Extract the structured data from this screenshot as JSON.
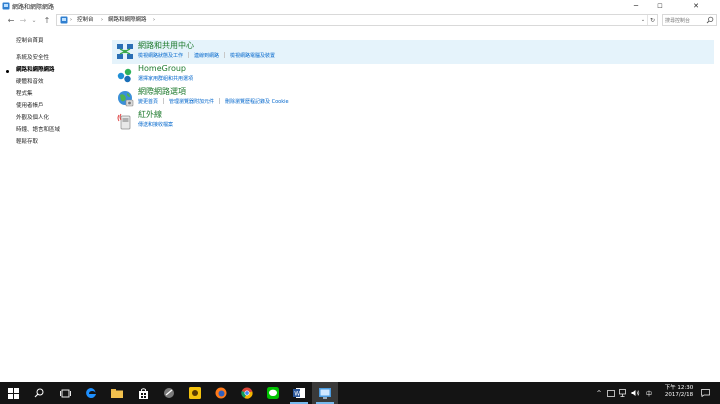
{
  "window": {
    "title": "網路和網際網路",
    "controls": {
      "minimize": "─",
      "maximize": "☐",
      "close": "✕"
    }
  },
  "nav": {
    "back": "←",
    "forward": "→",
    "recent": "⌄",
    "up": "↑"
  },
  "address": {
    "breadcrumbs": [
      "控制台",
      "網路和網際網路"
    ],
    "separators": [
      "›",
      "›",
      "›"
    ],
    "dropdown": "⌄",
    "refresh": "↻"
  },
  "search": {
    "placeholder": "搜尋控制台"
  },
  "sidebar": {
    "items": [
      {
        "label": "控制台首頁",
        "current": false
      },
      {
        "label": "系統及安全性",
        "current": false
      },
      {
        "label": "網路和網際網路",
        "current": true
      },
      {
        "label": "硬體和音效",
        "current": false
      },
      {
        "label": "程式集",
        "current": false
      },
      {
        "label": "使用者帳戶",
        "current": false
      },
      {
        "label": "外觀及個人化",
        "current": false
      },
      {
        "label": "時鐘、語言和區域",
        "current": false
      },
      {
        "label": "輕鬆存取",
        "current": false
      }
    ]
  },
  "categories": [
    {
      "title": "網路和共用中心",
      "icon": "network-sharing-center-icon",
      "links": [
        "檢視網路狀態及工作",
        "連線到網路",
        "檢視網路電腦及裝置"
      ]
    },
    {
      "title": "HomeGroup",
      "icon": "homegroup-icon",
      "links": [
        "選擇家用群組和共用選項"
      ]
    },
    {
      "title": "網際網路選項",
      "icon": "internet-options-icon",
      "links": [
        "變更首頁",
        "管理瀏覽器附加元件",
        "刪除瀏覽歷程記錄及 Cookie"
      ]
    },
    {
      "title": "紅外線",
      "icon": "infrared-icon",
      "links": [
        "傳送和接收檔案"
      ]
    }
  ],
  "taskbar": {
    "apps": [
      "start-icon",
      "search-icon",
      "task-view-icon",
      "edge-icon",
      "file-explorer-icon",
      "store-icon",
      "app-icon",
      "app2-icon",
      "firefox-icon",
      "chrome-icon",
      "line-icon",
      "word-icon",
      "control-panel-icon"
    ],
    "tray": {
      "chevron": "^",
      "ime": "中",
      "volume": "🔊"
    },
    "clock": {
      "time": "下午 12:30",
      "date": "2017/2/18"
    }
  },
  "colors": {
    "accent_link": "#0066cc",
    "category_title": "#1e7a2d",
    "highlight": "#e5f3fb",
    "taskbar": "#141414"
  }
}
